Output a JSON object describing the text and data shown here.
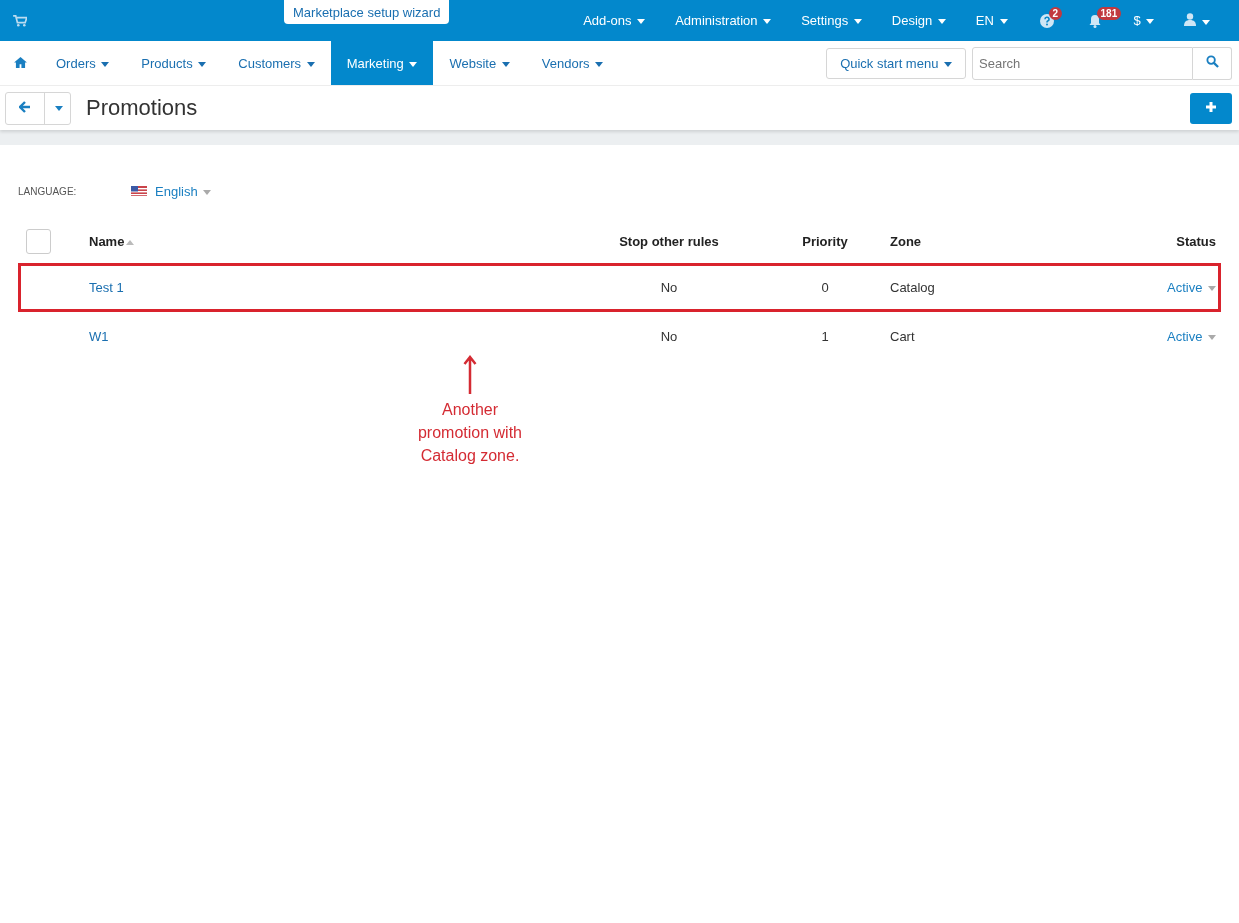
{
  "top_bar": {
    "wizard_tab": "Marketplace setup wizard",
    "items": [
      {
        "kind": "menu",
        "label": "Add-ons"
      },
      {
        "kind": "menu",
        "label": "Administration"
      },
      {
        "kind": "menu",
        "label": "Settings"
      },
      {
        "kind": "menu",
        "label": "Design"
      },
      {
        "kind": "menu",
        "label": "EN"
      },
      {
        "kind": "help",
        "badge": "2"
      },
      {
        "kind": "bell",
        "badge": "181"
      },
      {
        "kind": "menu",
        "label": "$"
      },
      {
        "kind": "user"
      }
    ]
  },
  "nav": {
    "tabs": [
      {
        "label": "Orders",
        "selected": false
      },
      {
        "label": "Products",
        "selected": false
      },
      {
        "label": "Customers",
        "selected": false
      },
      {
        "label": "Marketing",
        "selected": true
      },
      {
        "label": "Website",
        "selected": false
      },
      {
        "label": "Vendors",
        "selected": false
      }
    ],
    "quick_start": "Quick start menu",
    "search": {
      "placeholder": "Search"
    }
  },
  "page": {
    "title": "Promotions"
  },
  "language": {
    "label": "LANGUAGE:",
    "value": "English"
  },
  "table": {
    "select_all": {
      "checked": false
    },
    "columns": [
      "Name",
      "Stop other rules",
      "Priority",
      "Zone",
      "Status"
    ],
    "rows": [
      {
        "name": "Test 1",
        "stop_other_rules": "No",
        "priority": "0",
        "zone": "Catalog",
        "status": "Active",
        "highlighted": true
      },
      {
        "name": "W1",
        "stop_other_rules": "No",
        "priority": "1",
        "zone": "Cart",
        "status": "Active",
        "highlighted": false
      }
    ]
  },
  "annotation": {
    "text": [
      "Another",
      "promotion with",
      "Catalog zone."
    ]
  }
}
